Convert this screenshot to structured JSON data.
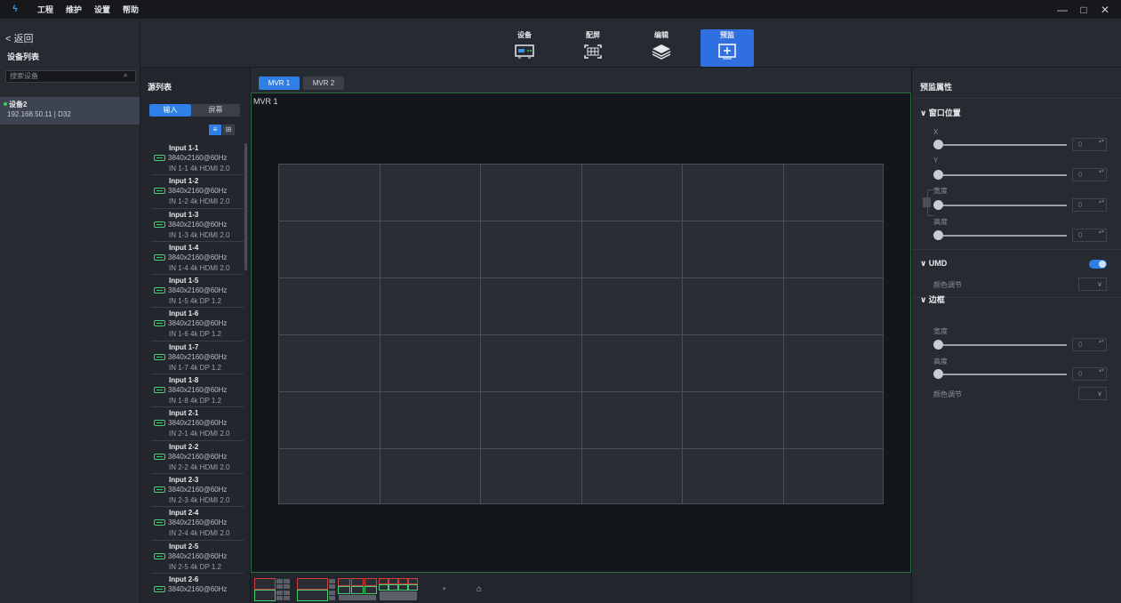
{
  "app": {
    "logo": "ϟ",
    "menu": [
      "工程",
      "维护",
      "设置",
      "帮助"
    ],
    "window_controls": [
      "—",
      "□",
      "✕"
    ]
  },
  "left_panel": {
    "back_label": "< 返回",
    "device_list_title": "设备列表",
    "search_placeholder": "搜索设备",
    "search_icon": "⌕",
    "device": {
      "name": "设备2",
      "info": "192.168.50.11 | D32",
      "status_color": "#39d353"
    }
  },
  "toolbar": {
    "tools": [
      {
        "label": "设备",
        "icon": "device-icon"
      },
      {
        "label": "配屏",
        "icon": "screen-config-icon"
      },
      {
        "label": "编辑",
        "icon": "layers-icon"
      },
      {
        "label": "预监",
        "icon": "preview-icon",
        "active": true
      }
    ]
  },
  "source_panel": {
    "title": "源列表",
    "segment_input": "输入",
    "segment_screen": "屏幕",
    "view_list_icon": "≡",
    "view_grid_icon": "⊞",
    "items": [
      {
        "name": "Input 1-1",
        "res": "3840x2160@60Hz",
        "port": "IN 1-1  4k  HDMI 2.0"
      },
      {
        "name": "Input 1-2",
        "res": "3840x2160@60Hz",
        "port": "IN 1-2  4k  HDMI 2.0"
      },
      {
        "name": "Input 1-3",
        "res": "3840x2160@60Hz",
        "port": "IN 1-3  4k  HDMI 2.0"
      },
      {
        "name": "Input 1-4",
        "res": "3840x2160@60Hz",
        "port": "IN 1-4  4k  HDMI 2.0"
      },
      {
        "name": "Input 1-5",
        "res": "3840x2160@60Hz",
        "port": "IN 1-5  4k  DP 1.2"
      },
      {
        "name": "Input 1-6",
        "res": "3840x2160@60Hz",
        "port": "IN 1-6  4k  DP 1.2"
      },
      {
        "name": "Input 1-7",
        "res": "3840x2160@60Hz",
        "port": "IN 1-7  4k  DP 1.2"
      },
      {
        "name": "Input 1-8",
        "res": "3840x2160@60Hz",
        "port": "IN 1-8  4k  DP 1.2"
      },
      {
        "name": "Input 2-1",
        "res": "3840x2160@60Hz",
        "port": "IN 2-1  4k  HDMI 2.0"
      },
      {
        "name": "Input 2-2",
        "res": "3840x2160@60Hz",
        "port": "IN 2-2  4k  HDMI 2.0"
      },
      {
        "name": "Input 2-3",
        "res": "3840x2160@60Hz",
        "port": "IN 2-3  4k  HDMI 2.0"
      },
      {
        "name": "Input 2-4",
        "res": "3840x2160@60Hz",
        "port": "IN 2-4  4k  HDMI 2.0"
      },
      {
        "name": "Input 2-5",
        "res": "3840x2160@60Hz",
        "port": "IN 2-5  4k  DP 1.2"
      },
      {
        "name": "Input 2-6",
        "res": "3840x2160@60Hz",
        "port": ""
      }
    ]
  },
  "mvr": {
    "tabs": [
      {
        "label": "MVR 1",
        "active": true
      },
      {
        "label": "MVR 2",
        "active": false
      }
    ],
    "canvas_label": "MVR 1"
  },
  "properties": {
    "title": "预监属性",
    "window_position": {
      "title": "∨ 窗口位置",
      "x_label": "X",
      "y_label": "Y",
      "width_label": "宽度",
      "height_label": "高度",
      "x": "0",
      "y": "0",
      "width": "0",
      "height": "0"
    },
    "umd": {
      "title": "∨ UMD",
      "color_label": "颜色调节",
      "enabled": true
    },
    "border": {
      "title": "∨ 边框",
      "width_label": "宽度",
      "height_label": "高度",
      "color_label": "颜色调节",
      "width": "0",
      "height": "0"
    },
    "dropdown_arrow": "∨",
    "spin_arrows": "▴▾"
  },
  "bottom": {
    "icon_a": "▫",
    "icon_b": "⌂"
  }
}
